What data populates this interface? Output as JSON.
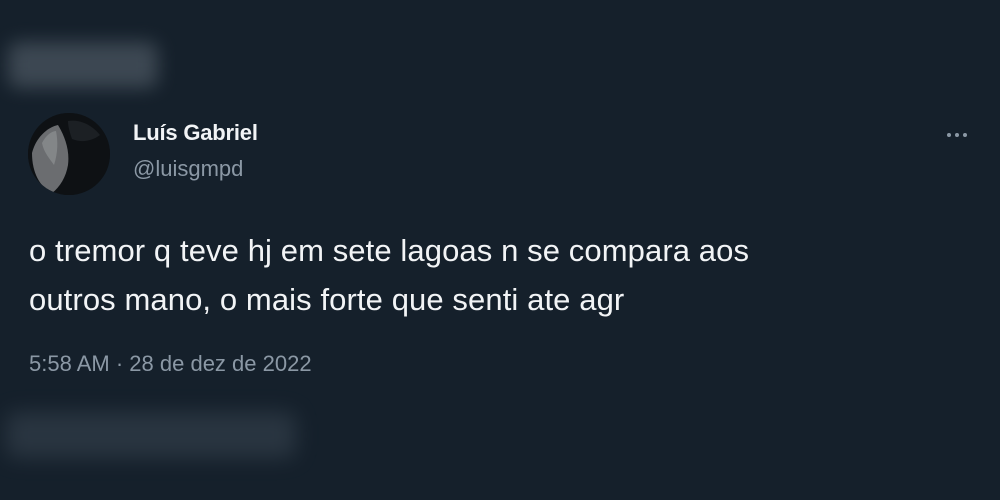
{
  "author": {
    "display_name": "Luís Gabriel",
    "handle": "@luisgmpd"
  },
  "tweet": {
    "lines": [
      "o tremor q teve hj em sete lagoas n se compara aos",
      "outros mano, o mais forte que senti ate agr"
    ]
  },
  "meta": {
    "time": "5:58 AM",
    "separator": "·",
    "date": "28 de dez de 2022"
  },
  "icons": {
    "more": "more-horizontal-icon",
    "avatar": "profile-photo"
  },
  "colors": {
    "background": "#15202b",
    "primary_text": "#f2f4f6",
    "secondary_text": "#8b98a5"
  }
}
